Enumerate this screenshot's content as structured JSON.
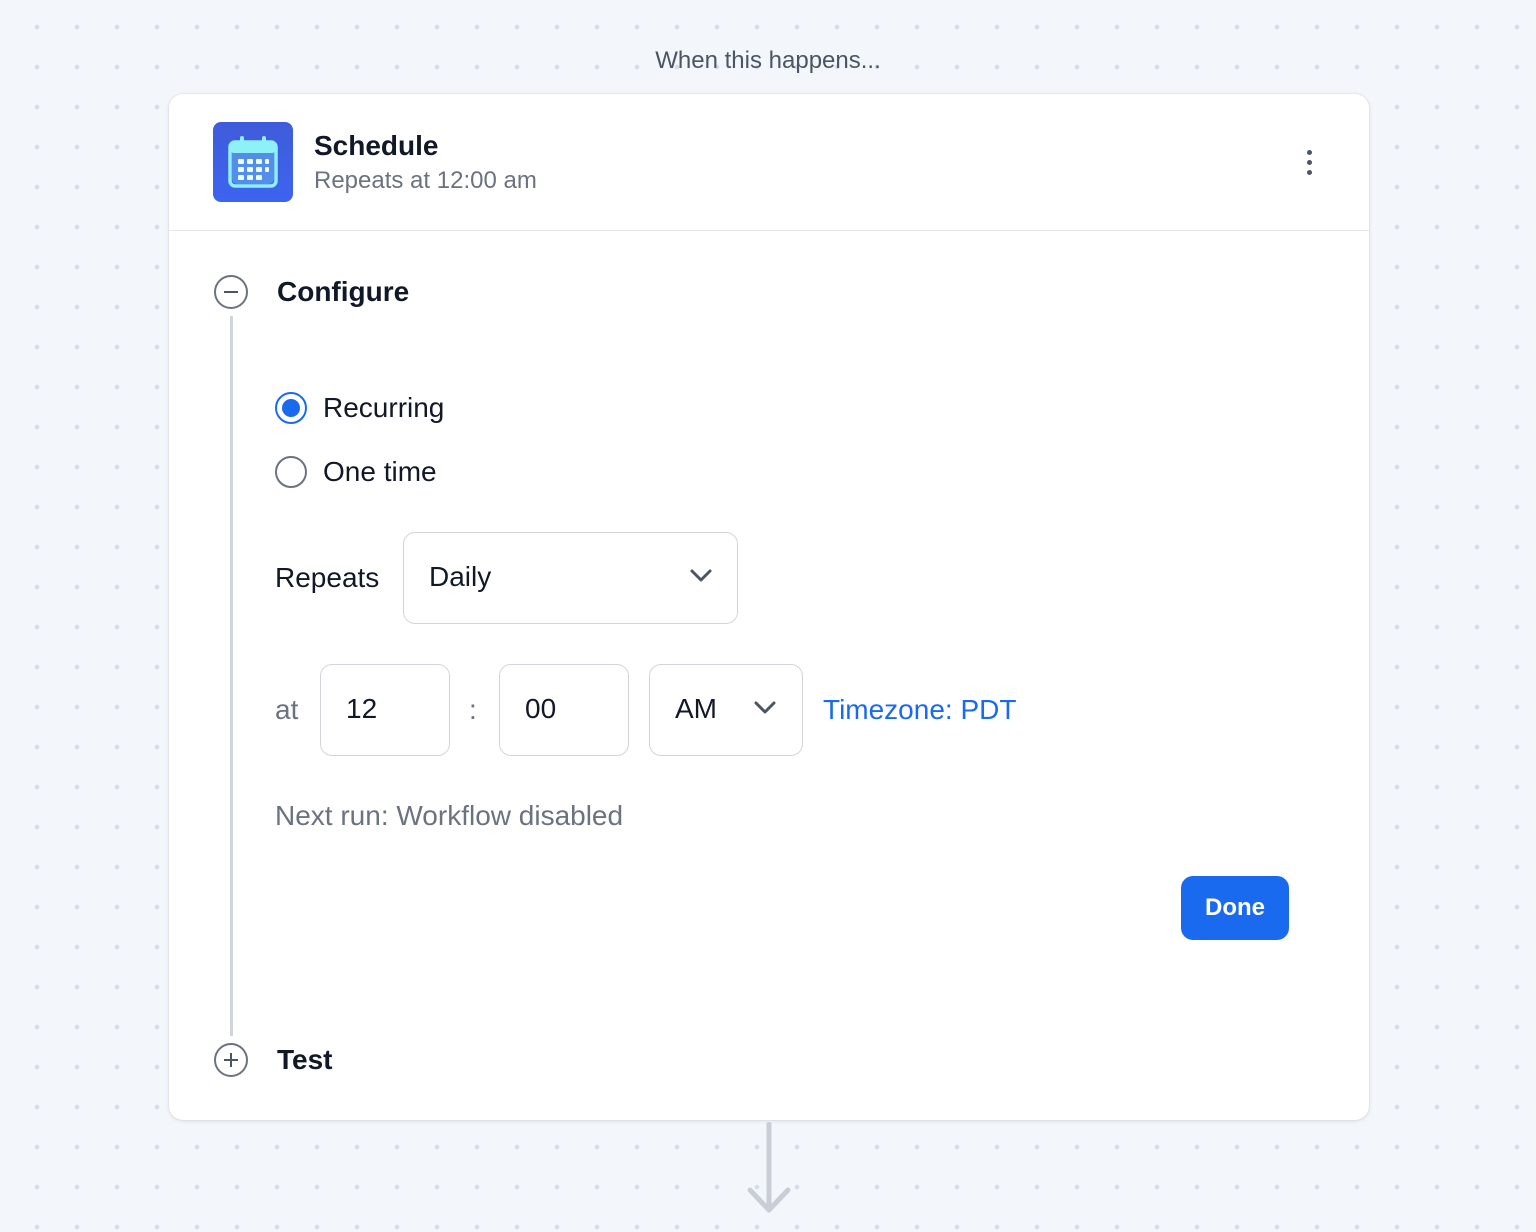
{
  "canvas": {
    "caption": "When this happens..."
  },
  "trigger": {
    "icon": "calendar-icon",
    "name": "Schedule",
    "summary": "Repeats at 12:00 am",
    "more_icon": "more-vertical-icon"
  },
  "steps": {
    "configure": {
      "title": "Configure",
      "state_icon": "collapse-minus-icon"
    },
    "test": {
      "title": "Test",
      "state_icon": "expand-plus-icon"
    }
  },
  "schedule_type": {
    "options": [
      {
        "label": "Recurring",
        "selected": true
      },
      {
        "label": "One time",
        "selected": false
      }
    ]
  },
  "repeats": {
    "label": "Repeats",
    "value": "Daily"
  },
  "time": {
    "label": "at",
    "hour": "12",
    "separator": ":",
    "minute": "00",
    "meridiem": "AM"
  },
  "timezone": {
    "link": "Timezone: PDT"
  },
  "next_run": "Next run: Workflow disabled",
  "actions": {
    "done_label": "Done"
  },
  "colors": {
    "accent": "#1a6af0",
    "icon_bg": "#3d5ee8",
    "background": "#f3f7fc"
  }
}
